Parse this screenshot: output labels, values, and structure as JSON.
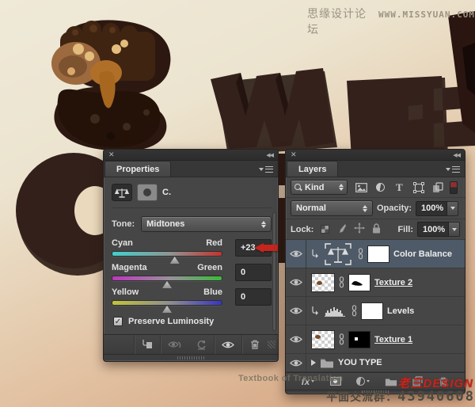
{
  "watermarks": {
    "site_name": "思缘设计论坛",
    "site_url": "WWW.MISSYUAN.COM",
    "textbook": "Textbook of Translation",
    "brand": "老三DESIGN",
    "qq_label": "平面交流群：",
    "qq_number": "43940608"
  },
  "glyphs": {
    "close": "✕",
    "collapse": "◀◀",
    "check": "✓",
    "fx": "fx",
    "type_filter": "T"
  },
  "properties_panel": {
    "tab": "Properties",
    "header_label": "C.",
    "tone_label": "Tone:",
    "tone_value": "Midtones",
    "sliders": [
      {
        "left_label": "Cyan",
        "right_label": "Red",
        "value": "+23",
        "thumb_percent": 57
      },
      {
        "left_label": "Magenta",
        "right_label": "Green",
        "value": "0",
        "thumb_percent": 50
      },
      {
        "left_label": "Yellow",
        "right_label": "Blue",
        "value": "0",
        "thumb_percent": 50
      }
    ],
    "preserve_luminosity_label": "Preserve Luminosity",
    "preserve_luminosity_checked": true
  },
  "layers_panel": {
    "tab": "Layers",
    "kind_label": "Kind",
    "blend_mode": "Normal",
    "opacity_label": "Opacity:",
    "opacity_value": "100%",
    "lock_label": "Lock:",
    "fill_label": "Fill:",
    "fill_value": "100%",
    "layers": [
      {
        "name": "Color Balance",
        "type": "adjustment-color-balance",
        "selected": true,
        "clipped": true
      },
      {
        "name": "Texture 2",
        "type": "pixel-with-mask",
        "underlined": true
      },
      {
        "name": "Levels",
        "type": "adjustment-levels",
        "clipped": true
      },
      {
        "name": "Texture 1",
        "type": "pixel-with-mask",
        "underlined": true
      },
      {
        "name": "YOU TYPE",
        "type": "group"
      }
    ]
  },
  "colors": {
    "panel_bg": "#464646",
    "selected_row": "#4e5a67",
    "accent_red": "#c5251c",
    "bg_top": "#eee8d6",
    "bg_bottom": "#d3a483",
    "chocolate_letter": "#33201b"
  }
}
